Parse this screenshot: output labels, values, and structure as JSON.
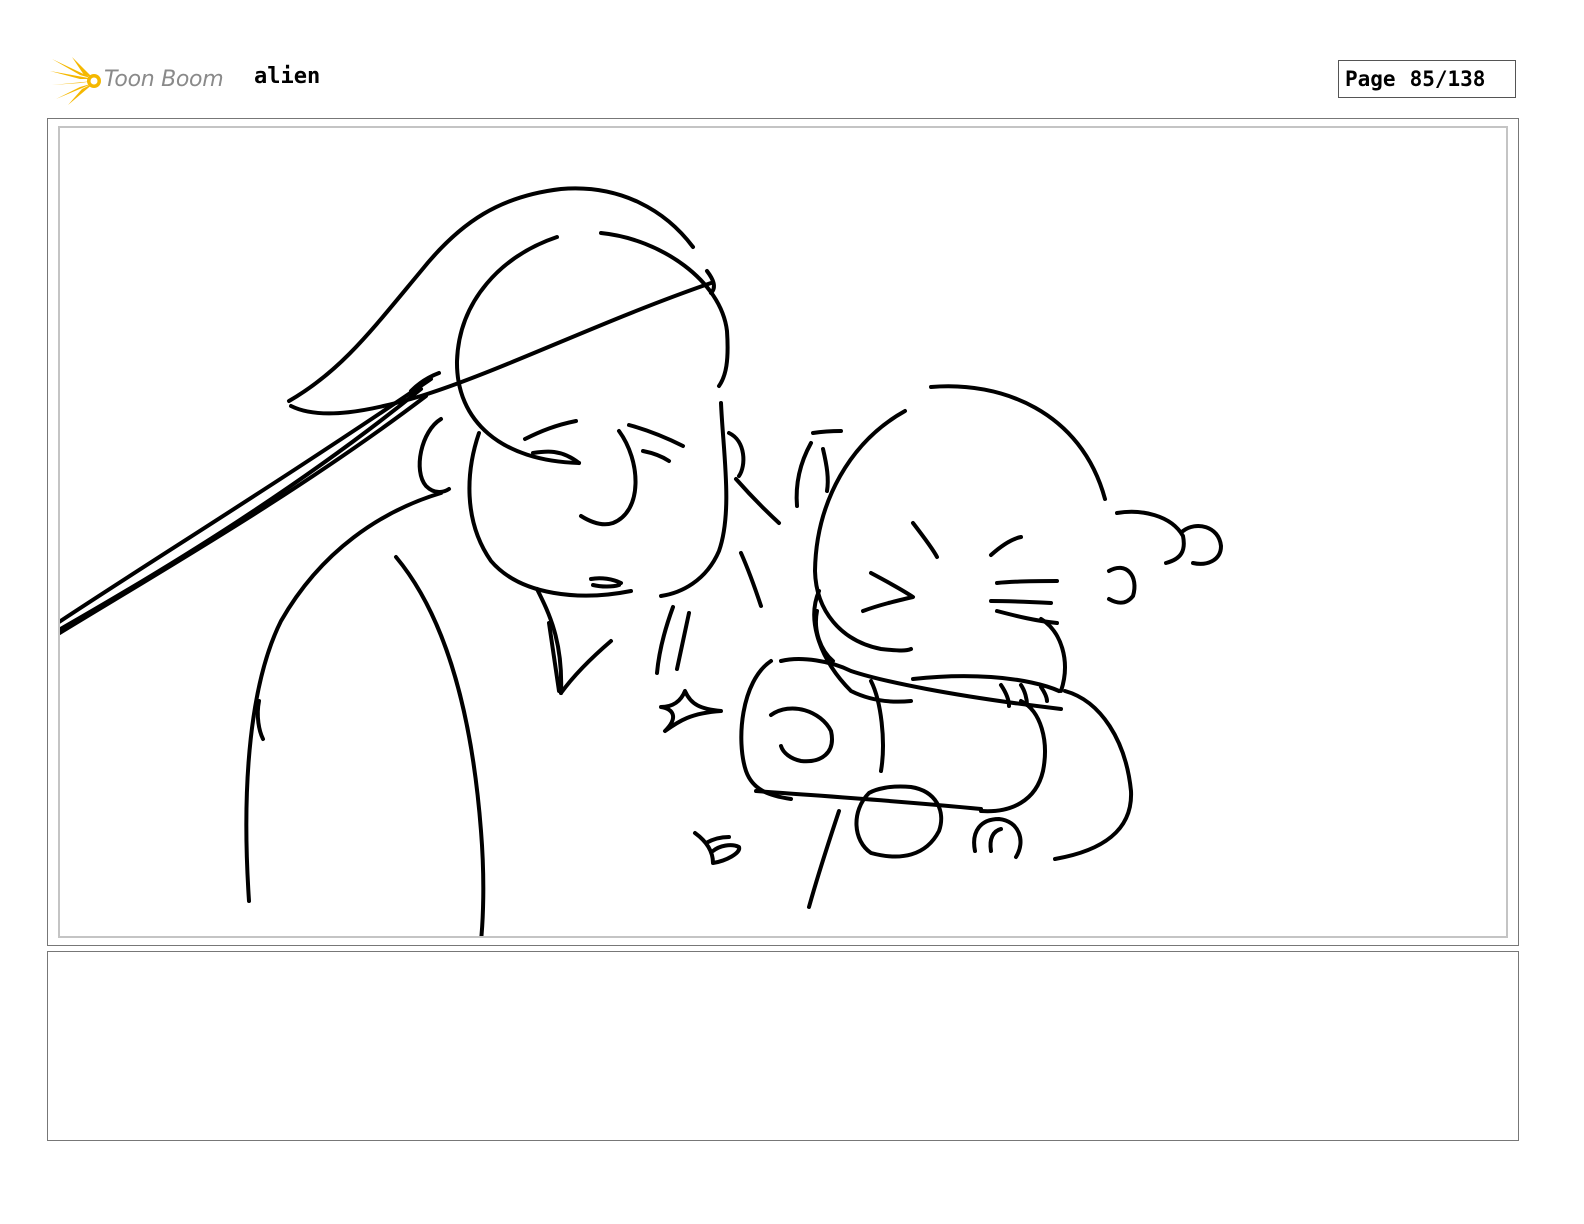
{
  "header": {
    "logo_text": "Toon Boom",
    "project_title": "alien",
    "page_label": "Page",
    "page_number": "85/138"
  },
  "panel": {
    "notes": ""
  },
  "colors": {
    "logo_accent": "#f5b800",
    "logo_text": "#8a8a8a",
    "ink": "#000000",
    "frame_border": "#777777",
    "safe_area_border": "#c4c4c4"
  }
}
